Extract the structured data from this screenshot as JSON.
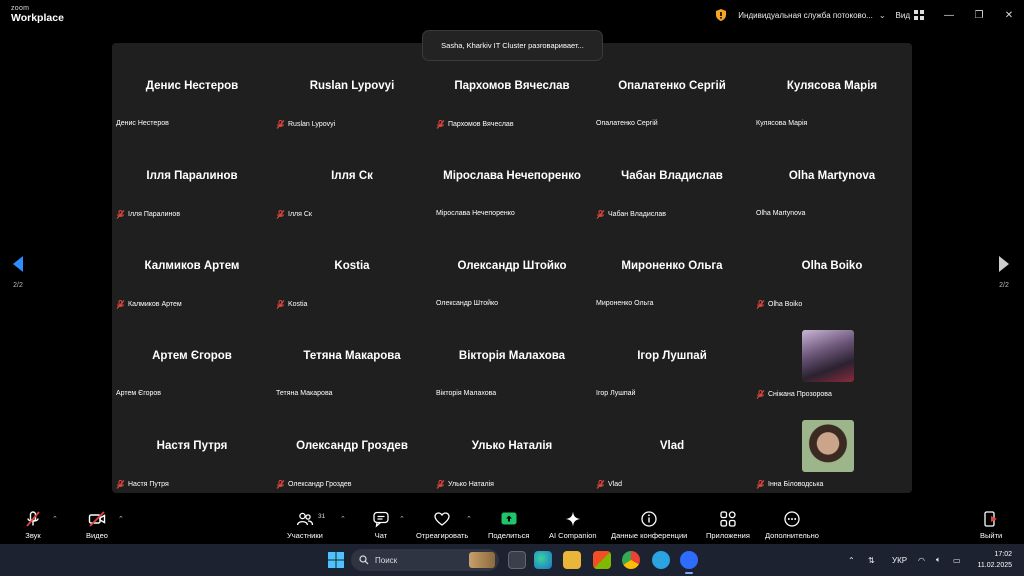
{
  "app": {
    "logo_line1": "zoom",
    "logo_line2": "Workplace",
    "meeting_title": "Индивидуальная служба потоково...",
    "view_label": "Вид"
  },
  "speaker_toast": "Sasha, Kharkiv IT Cluster разговаривает...",
  "pagination": {
    "left": "2/2",
    "right": "2/2"
  },
  "participants": [
    {
      "display": "Денис Нестеров",
      "caption": "Денис Нестеров",
      "muted": false
    },
    {
      "display": "Ruslan Lypovyi",
      "caption": "Ruslan Lypovyi",
      "muted": true
    },
    {
      "display": "Пархомов Вячеслав",
      "caption": "Пархомов Вячеслав",
      "muted": true
    },
    {
      "display": "Опалатенко Сергій",
      "caption": "Опалатенко Сергій",
      "muted": false
    },
    {
      "display": "Кулясова Марія",
      "caption": "Кулясова Марія",
      "muted": false
    },
    {
      "display": "Ілля Паралинов",
      "caption": "Ілля Паралинов",
      "muted": true
    },
    {
      "display": "Ілля Ск",
      "caption": "Ілля Ск",
      "muted": true
    },
    {
      "display": "Мірослава Нечепоренко",
      "caption": "Мірослава Нечепоренко",
      "muted": false
    },
    {
      "display": "Чабан Владислав",
      "caption": "Чабан Владислав",
      "muted": true
    },
    {
      "display": "Olha Martynova",
      "caption": "Olha Martynova",
      "muted": false
    },
    {
      "display": "Калмиков Артем",
      "caption": "Калмиков Артем",
      "muted": true
    },
    {
      "display": "Kostia",
      "caption": "Kostia",
      "muted": true
    },
    {
      "display": "Олександр Штойко",
      "caption": "Олександр Штойко",
      "muted": false
    },
    {
      "display": "Мироненко Ольга",
      "caption": "Мироненко Ольга",
      "muted": false
    },
    {
      "display": "Olha Boiko",
      "caption": "Olha Boiko",
      "muted": true
    },
    {
      "display": "Артем Єгоров",
      "caption": "Артем Єгоров",
      "muted": false
    },
    {
      "display": "Тетяна Макарова",
      "caption": "Тетяна Макарова",
      "muted": false
    },
    {
      "display": "Вікторія Малахова",
      "caption": "Вікторія Малахова",
      "muted": false
    },
    {
      "display": "Ігор Лушпай",
      "caption": "Ігор Лушпай",
      "muted": false
    },
    {
      "display": "",
      "caption": "Сніжана Прозорова",
      "muted": true,
      "photo": true
    },
    {
      "display": "Настя Путря",
      "caption": "Настя Путря",
      "muted": true
    },
    {
      "display": "Олександр Гроздев",
      "caption": "Олександр Гроздев",
      "muted": true
    },
    {
      "display": "Улько Наталія",
      "caption": "Улько Наталія",
      "muted": true
    },
    {
      "display": "Vlad",
      "caption": "Vlad",
      "muted": true
    },
    {
      "display": "",
      "caption": "Інна Біловодська",
      "muted": true,
      "photo": true
    }
  ],
  "toolbar": {
    "audio": "Звук",
    "video": "Видео",
    "participants": "Участники",
    "participants_count": "31",
    "chat": "Чат",
    "react": "Отреагировать",
    "share": "Поделиться",
    "ai": "AI Companion",
    "info": "Данные конференции",
    "apps": "Приложения",
    "more": "Дополнительно",
    "leave": "Выйти"
  },
  "colors": {
    "accent_blue": "#1f8fff",
    "mute_red": "#e0443e",
    "share_green": "#21c46b",
    "gallery_bg": "#1f1f1f"
  },
  "taskbar": {
    "search_placeholder": "Поиск",
    "language": "УКР",
    "time": "17:02",
    "date": "11.02.2025"
  }
}
